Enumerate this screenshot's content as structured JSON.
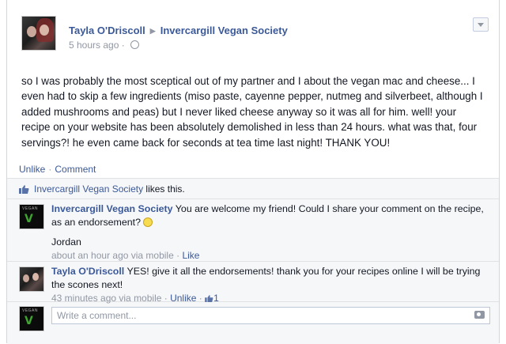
{
  "post": {
    "author": "Tayla O'Driscoll",
    "target": "Invercargill Vegan Society",
    "timestamp": "5 hours ago",
    "visibility_icon": "globe-icon",
    "text": "so I was probably the most sceptical out of my partner and I about the vegan mac and cheese... I even had to skip a few ingredients (miso paste, cayenne pepper, nutmeg and silverbeet, although I added mushrooms and peas) but I never liked cheese anyway so it was all for him. well! your recipe on your website has been absolutely demolished in less than 24 hours. what was that, four servings?! he even came back for seconds at tea time last night! THANK YOU!"
  },
  "actions": {
    "unlike": "Unlike",
    "comment": "Comment",
    "sep": "·"
  },
  "likes": {
    "liker": "Invercargill Vegan Society",
    "suffix": "likes this."
  },
  "comments": [
    {
      "author": "Invercargill Vegan Society",
      "text": "You are welcome my friend! Could I share your comment on the recipe, as an endorsement?",
      "signature": "Jordan",
      "meta": "about an hour ago via mobile",
      "action": "Like"
    },
    {
      "author": "Tayla O'Driscoll",
      "text": "YES! give it all the endorsements! thank you for your recipes online I will be trying the scones next!",
      "meta": "43 minutes ago via mobile",
      "action": "Unlike",
      "like_count": "1"
    }
  ],
  "composer": {
    "placeholder": "Write a comment..."
  },
  "colors": {
    "link": "#3b5998",
    "meta": "#9197a3",
    "feedback_bg": "#f6f7f9"
  }
}
